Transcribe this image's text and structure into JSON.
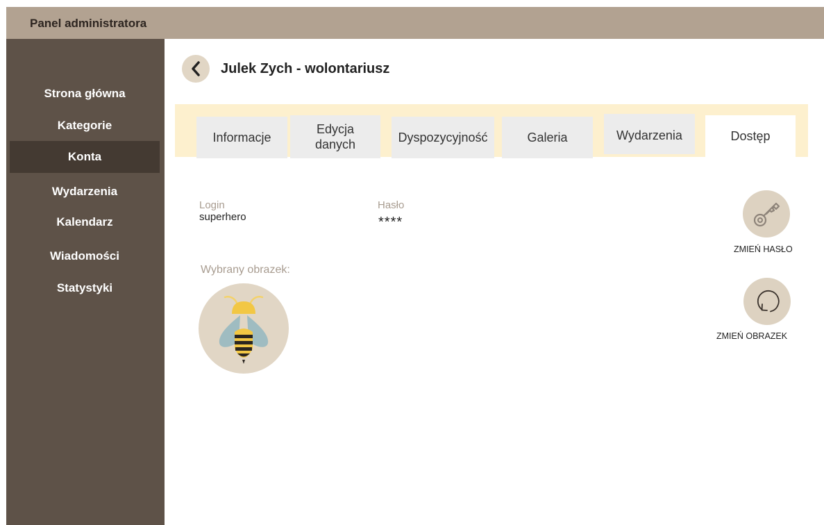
{
  "header": {
    "title": "Panel administratora"
  },
  "sidebar": {
    "items": [
      {
        "label": "Strona główna"
      },
      {
        "label": "Kategorie"
      },
      {
        "label": "Konta",
        "active": true
      },
      {
        "label": "Wydarzenia"
      },
      {
        "label": "Kalendarz"
      },
      {
        "label": "Wiadomości"
      },
      {
        "label": "Statystyki"
      }
    ]
  },
  "page": {
    "title": "Julek Zych  - wolontariusz"
  },
  "tabs": [
    {
      "label": "Informacje"
    },
    {
      "label": "Edycja\ndanych"
    },
    {
      "label": "Dyspozycyjność"
    },
    {
      "label": "Galeria"
    },
    {
      "label": "Wydarzenia"
    },
    {
      "label": "Dostęp",
      "active": true
    }
  ],
  "access": {
    "login_label": "Login",
    "login_value": "superhero",
    "password_label": "Hasło",
    "password_value": "****",
    "image_label": "Wybrany obrazek:"
  },
  "actions": {
    "change_password": "ZMIEŃ HASŁO",
    "change_image": "ZMIEŃ OBRAZEK"
  },
  "icons": {
    "back": "chevron-left-icon",
    "key": "key-icon",
    "refresh": "refresh-icon",
    "avatar": "bee-icon"
  },
  "colors": {
    "topbar": "#b2a291",
    "sidebar": "#5e5248",
    "sidebar_active": "#443a32",
    "tabbar": "#fdf0ce",
    "icon_bg": "#e1d6c5",
    "icon_stroke": "#8d8379"
  }
}
